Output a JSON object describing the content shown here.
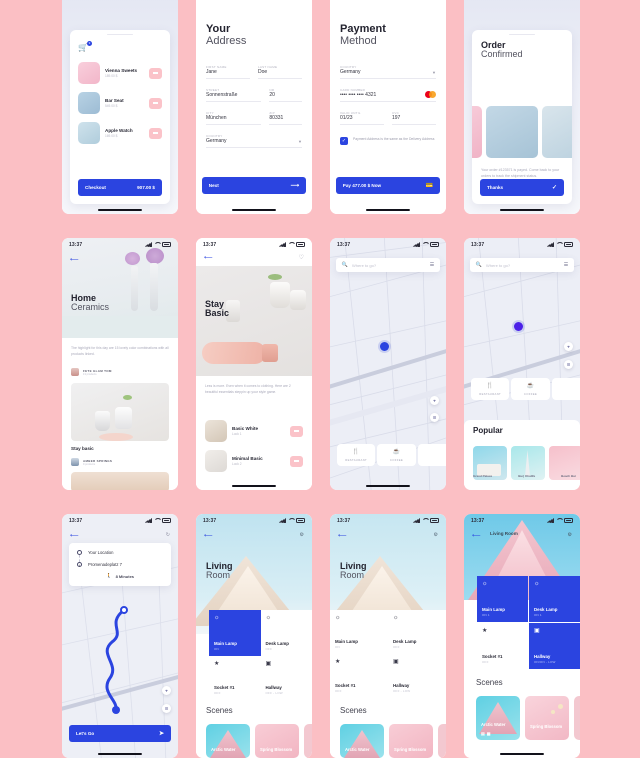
{
  "background_color": "#fbbfc4",
  "accent_color": "#2b44e0",
  "pink_color": "#fbc3c9",
  "status_bar": {
    "time": "13:37",
    "signal": "signal-icon",
    "wifi": "wifi-icon",
    "battery": "battery-icon"
  },
  "screens": {
    "cart": {
      "items": [
        {
          "name": "Vienna Sweets",
          "price": "189.00 $",
          "thumb": "#f6c3d4"
        },
        {
          "name": "Bar Seat",
          "price": "549.00 $",
          "thumb": "#a9c6da"
        },
        {
          "name": "Apple Watch",
          "price": "169.00 $",
          "thumb": "#bcd6e2"
        }
      ],
      "cart_icon": "shopping-cart-icon",
      "badge": "3",
      "checkout_label": "Checkout",
      "total": "907.00 $"
    },
    "address": {
      "title_bold": "Your",
      "title_light": "Address",
      "fields": [
        {
          "label": "FIRST NAME",
          "value": "Jane"
        },
        {
          "label": "LAST NAME",
          "value": "Doe"
        },
        {
          "label": "STREET",
          "value": "Sonnenstraße"
        },
        {
          "label": "NR",
          "value": "20"
        },
        {
          "label": "CITY",
          "value": "München"
        },
        {
          "label": "ZIP",
          "value": "80331"
        }
      ],
      "country_label": "COUNTRY",
      "country_value": "Germany",
      "next_label": "Next",
      "next_icon": "arrow-right-icon"
    },
    "payment": {
      "title_bold": "Payment",
      "title_light": "Method",
      "country_label": "COUNTRY",
      "country_value": "Germany",
      "card_label": "CARD NUMBER",
      "card_value": "•••• •••• •••• 4321",
      "card_brand_icon": "mastercard-icon",
      "expiry_label": "VALID UNTIL",
      "expiry_value": "01/23",
      "cvc_label": "CVC",
      "cvc_value": "197",
      "checkbox_checked": true,
      "checkbox_text": "Payment Address is the same as the Delivery Address",
      "pay_label": "Pay 477.00 $ Now",
      "pay_icon": "card-icon"
    },
    "confirmed": {
      "title_bold": "Order",
      "title_light": "Confirmed",
      "body": "Your order #123571 is payed. Come back to your orders to track the shipment status.",
      "thanks_label": "Thanks",
      "check_icon": "check-icon"
    },
    "home_ceramics": {
      "title_bold": "Home",
      "title_light": "Ceramics",
      "back_icon": "arrow-left-icon",
      "intro": "The highlight for this day are 15 lovely color combinations with all products linked.",
      "tag_1": "FETE GLAM TOM",
      "tag_1_sub": "13 products",
      "section": "Stay basic",
      "tag_2": "AMBER SPRINGS",
      "tag_2_sub": "9 products"
    },
    "stay_basic": {
      "title_bold": "Stay",
      "title_light": "Basic",
      "back_icon": "arrow-left-icon",
      "fav_icon": "heart-icon",
      "intro": "Less is more. Even when it comes to clothing. Here are 2 beautiful essentials steppin up your style game.",
      "items": [
        {
          "name": "Basic White",
          "price": "Look 1",
          "thumb": "#ded5ca"
        },
        {
          "name": "Minimal Basic",
          "price": "Look 2",
          "thumb": "#e6e4e2"
        }
      ]
    },
    "map": {
      "search_placeholder": "Where to go?",
      "search_icon": "search-icon",
      "filter_icon": "sliders-icon",
      "locate_icon": "locate-icon",
      "layers_icon": "layers-icon",
      "categories": [
        {
          "label": "RESTAURANT",
          "icon": "cutlery-icon",
          "color": "#f29ba8"
        },
        {
          "label": "COFFEE",
          "icon": "coffee-cup-icon",
          "color": "#2b44e0"
        }
      ]
    },
    "map_popular": {
      "search_placeholder": "Where to go?",
      "search_icon": "search-icon",
      "filter_icon": "sliders-icon",
      "section_title": "Popular",
      "cards": [
        {
          "name": "Grand Palace",
          "thumb": "#7fd2e8"
        },
        {
          "name": "Burj Khalifa",
          "thumb": "#97e0e8"
        },
        {
          "name": "Beach Bar",
          "thumb": "#f4b9c5"
        }
      ]
    },
    "navigate": {
      "back_icon": "arrow-left-icon",
      "refresh_icon": "refresh-icon",
      "from_icon": "circle-icon",
      "from_label": "Your Location",
      "to_icon": "pin-icon",
      "to_label": "Promenadeplatz 7",
      "duration_icon": "walk-icon",
      "duration": "8 Minutes",
      "go_label": "Let's Go",
      "go_icon": "navigate-icon"
    },
    "living_room_a": {
      "back_icon": "arrow-left-icon",
      "settings_icon": "gear-icon",
      "title_bold": "Living",
      "title_light": "Room",
      "devices": [
        {
          "name": "Main Lamp",
          "status": "ON",
          "icon": "bulb-icon",
          "on": true
        },
        {
          "name": "Desk Lamp",
          "status": "OFF",
          "icon": "bulb-icon",
          "on": false
        },
        {
          "name": "Socket #1",
          "status": "OFF",
          "icon": "plug-icon",
          "on": false
        },
        {
          "name": "Hallway",
          "status": "OFF - LOW",
          "icon": "door-icon",
          "on": false
        }
      ],
      "scenes_title": "Scenes",
      "scenes": [
        {
          "name": "Arctic Water",
          "color": "#5fd0e3"
        },
        {
          "name": "Spring Blossom",
          "color": "#f6c3cd"
        }
      ]
    },
    "living_room_b": {
      "back_icon": "arrow-left-icon",
      "settings_icon": "gear-icon",
      "header_title": "Living Room",
      "devices": [
        {
          "name": "Main Lamp",
          "status": "ON 1",
          "icon": "bulb-icon",
          "on": true
        },
        {
          "name": "Desk Lamp",
          "status": "ON 1",
          "icon": "bulb-icon",
          "on": true
        },
        {
          "name": "Socket #1",
          "status": "OFF",
          "icon": "plug-icon",
          "on": false
        },
        {
          "name": "Hallway",
          "status": "ON/ON - LOW",
          "icon": "door-icon",
          "on": true
        }
      ],
      "scenes_title": "Scenes",
      "scenes": [
        {
          "name": "Arctic Water",
          "color": "#5fd0e3"
        },
        {
          "name": "Spring Blossom",
          "color": "#f6c3cd"
        }
      ]
    }
  }
}
